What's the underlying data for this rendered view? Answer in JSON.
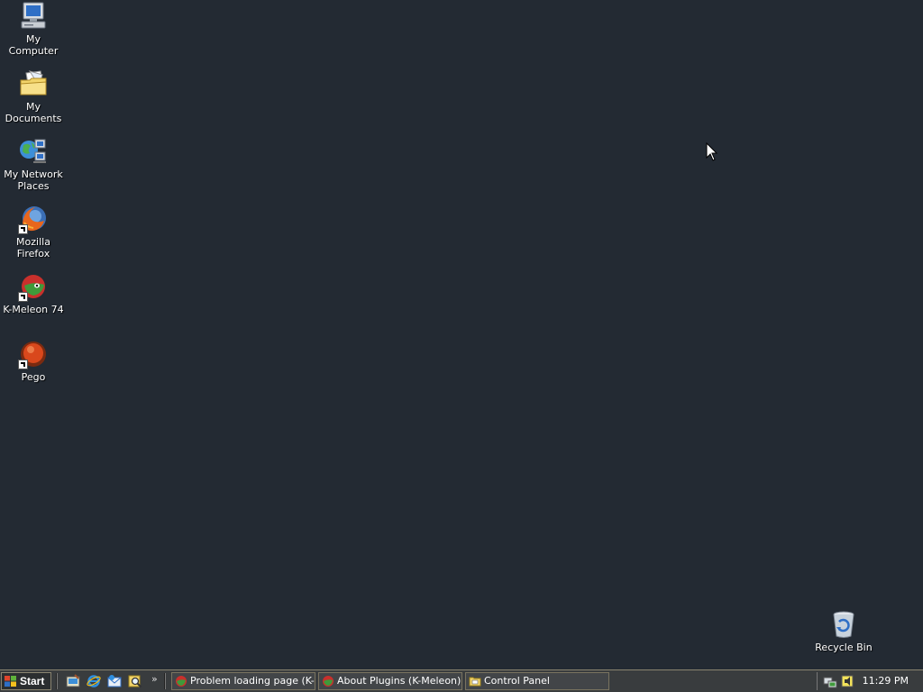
{
  "desktop": {
    "icons": [
      {
        "label": "My Computer",
        "icon": "computer-icon"
      },
      {
        "label": "My Documents",
        "icon": "documents-folder-icon"
      },
      {
        "label": "My Network Places",
        "icon": "network-icon"
      },
      {
        "label": "Mozilla Firefox",
        "icon": "firefox-icon"
      },
      {
        "label": "K-Meleon 74",
        "icon": "kmeleon-icon"
      },
      {
        "label": "Pego",
        "icon": "pego-icon"
      },
      {
        "label": "Recycle Bin",
        "icon": "recycle-bin-icon"
      }
    ],
    "background_color": "#232a33"
  },
  "taskbar": {
    "start_label": "Start",
    "quicklaunch": [
      "show-desktop-icon",
      "internet-explorer-icon",
      "outlook-icon",
      "search-icon"
    ],
    "overflow_label": "»",
    "tasks": [
      {
        "label": "Problem loading page (K-...",
        "icon": "kmeleon-icon"
      },
      {
        "label": "About Plugins (K-Meleon)",
        "icon": "kmeleon-icon"
      },
      {
        "label": "Control Panel",
        "icon": "folder-icon"
      }
    ],
    "tray_icons": [
      "network-tray-icon",
      "volume-tray-icon"
    ],
    "clock": "11:29 PM"
  }
}
